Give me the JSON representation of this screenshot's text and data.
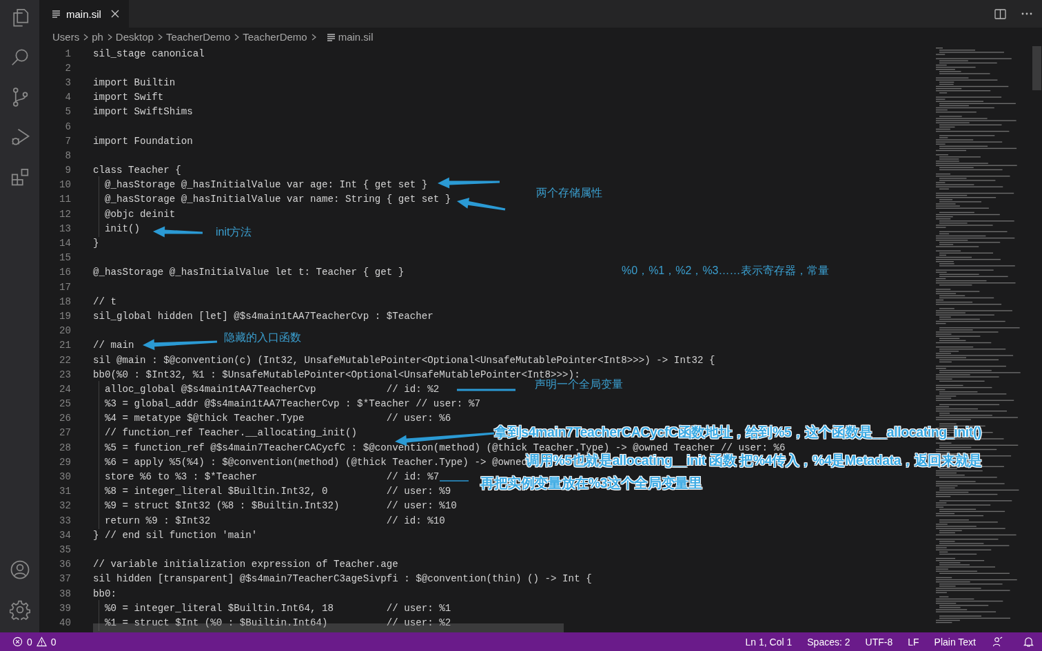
{
  "tab": {
    "title": "main.sil",
    "selected": true
  },
  "breadcrumbs": [
    "Users",
    "ph",
    "Desktop",
    "TeacherDemo",
    "TeacherDemo",
    "main.sil"
  ],
  "code_lines": [
    {
      "number": "1",
      "code": "sil_stage canonical"
    },
    {
      "number": "2"
    },
    {
      "number": "3",
      "code": "import Builtin"
    },
    {
      "number": "4",
      "code": "import Swift"
    },
    {
      "number": "5",
      "code": "import SwiftShims"
    },
    {
      "number": "6"
    },
    {
      "number": "7",
      "code": "import Foundation"
    },
    {
      "number": "8"
    },
    {
      "number": "9",
      "code": "class Teacher {"
    },
    {
      "number": "10",
      "code": "  @_hasStorage @_hasInitialValue var age: Int { get set }"
    },
    {
      "number": "11",
      "code": "  @_hasStorage @_hasInitialValue var name: String { get set }"
    },
    {
      "number": "12",
      "code": "  @objc deinit"
    },
    {
      "number": "13",
      "code": "  init()"
    },
    {
      "number": "14",
      "code": "}"
    },
    {
      "number": "15"
    },
    {
      "number": "16",
      "code": "@_hasStorage @_hasInitialValue let t: Teacher { get }"
    },
    {
      "number": "17"
    },
    {
      "number": "18",
      "code": "// t"
    },
    {
      "number": "19",
      "code": "sil_global hidden [let] @$s4main1tAA7TeacherCvp : $Teacher"
    },
    {
      "number": "20"
    },
    {
      "number": "21",
      "code": "// main"
    },
    {
      "number": "22",
      "code": "sil @main : $@convention(c) (Int32, UnsafeMutablePointer<Optional<UnsafeMutablePointer<Int8>>>) -> Int32 {"
    },
    {
      "number": "23",
      "code": "bb0(%0 : $Int32, %1 : $UnsafeMutablePointer<Optional<UnsafeMutablePointer<Int8>>>):"
    },
    {
      "number": "24",
      "code": "  alloc_global @$s4main1tAA7TeacherCvp",
      "comment": "// id: %2"
    },
    {
      "number": "25",
      "code": "  %3 = global_addr @$s4main1tAA7TeacherCvp : $*Teacher // user: %7"
    },
    {
      "number": "26",
      "code": "  %4 = metatype $@thick Teacher.Type",
      "comment": "// user: %6"
    },
    {
      "number": "27",
      "code": "  // function_ref Teacher.__allocating_init()"
    },
    {
      "number": "28",
      "code": "  %5 = function_ref @$s4main7TeacherCACycfC : $@convention(method) (@thick Teacher.Type) -> @owned Teacher // user: %6"
    },
    {
      "number": "29",
      "code": "  %6 = apply %5(%4) : $@convention(method) (@thick Teacher.Type) -> @owned"
    },
    {
      "number": "30",
      "code": "  store %6 to %3 : $*Teacher",
      "comment": "// id: %7"
    },
    {
      "number": "31",
      "code": "  %8 = integer_literal $Builtin.Int32, 0",
      "comment": "// user: %9"
    },
    {
      "number": "32",
      "code": "  %9 = struct $Int32 (%8 : $Builtin.Int32)",
      "comment": "// user: %10"
    },
    {
      "number": "33",
      "code": "  return %9 : $Int32",
      "comment": "// id: %10"
    },
    {
      "number": "34",
      "code": "} // end sil function 'main'"
    },
    {
      "number": "35"
    },
    {
      "number": "36",
      "code": "// variable initialization expression of Teacher.age"
    },
    {
      "number": "37",
      "code": "sil hidden [transparent] @$s4main7TeacherC3ageSivpfi : $@convention(thin) () -> Int {"
    },
    {
      "number": "38",
      "code": "bb0:"
    },
    {
      "number": "39",
      "code": "  %0 = integer_literal $Builtin.Int64, 18",
      "comment": "// user: %1"
    },
    {
      "number": "40",
      "code": "  %1 = struct $Int (%0 : $Builtin.Int64)",
      "comment": "// user: %2"
    }
  ],
  "annotations": [
    {
      "kind": "small",
      "text": "两个存储属性"
    },
    {
      "kind": "small",
      "text": "init方法"
    },
    {
      "kind": "small",
      "text": "%0，%1，%2，%3……表示寄存器，常量"
    },
    {
      "kind": "small",
      "text": "隐藏的入口函数"
    },
    {
      "kind": "small",
      "text": "声明一个全局变量"
    },
    {
      "kind": "large",
      "text": "拿到s4main7TeacherCACycfC函数地址，给到%5，这个函数是__allocating_init()"
    },
    {
      "kind": "large",
      "text": "调用%5也就是allocating__init 函数 把%4传入，%4是Metadata，返回来就是"
    },
    {
      "kind": "large",
      "text": "再把实例变量放在%3这个全局变量里"
    }
  ],
  "status_bar": {
    "errors": "0",
    "warnings": "0",
    "position": "Ln 1, Col 1",
    "indentation": "Spaces: 2",
    "encoding": "UTF-8",
    "line_ending": "LF",
    "language": "Plain Text"
  }
}
